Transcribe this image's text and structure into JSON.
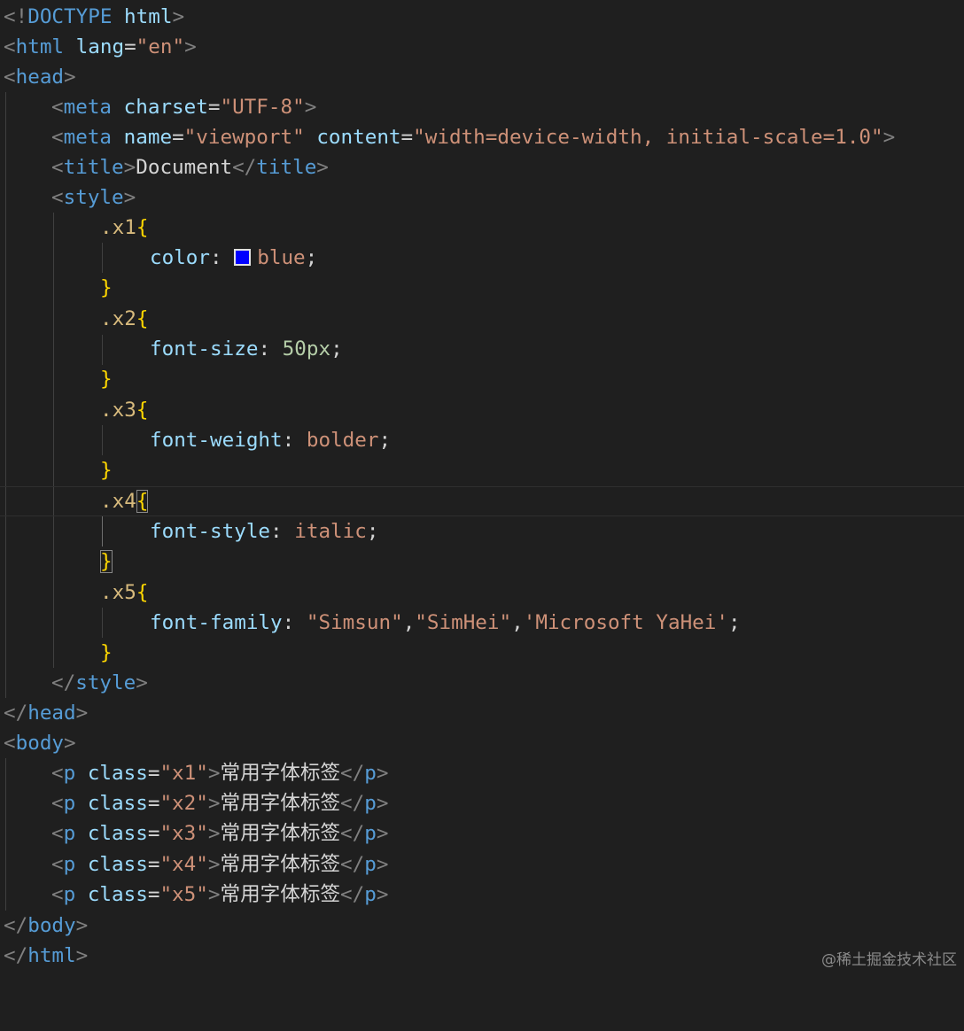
{
  "doctype": {
    "open": "<!",
    "keyword": "DOCTYPE",
    "name": "html",
    "close": ">"
  },
  "html_tag": {
    "name": "html",
    "attr": "lang",
    "eq": "=",
    "value": "\"en\""
  },
  "head_tag": {
    "name": "head"
  },
  "meta_charset": {
    "name": "meta",
    "attr": "charset",
    "eq": "=",
    "value": "\"UTF-8\""
  },
  "meta_viewport": {
    "name": "meta",
    "attr1": "name",
    "value1": "\"viewport\"",
    "attr2": "content",
    "value2": "\"width=device-width, initial-scale=1.0\""
  },
  "title_tag": {
    "name": "title",
    "text": "Document"
  },
  "style_tag": {
    "name": "style"
  },
  "css_rules": [
    {
      "selector": ".x1",
      "property": "color",
      "value": "blue",
      "swatch_color": "#0000ff"
    },
    {
      "selector": ".x2",
      "property": "font-size",
      "value": "50px"
    },
    {
      "selector": ".x3",
      "property": "font-weight",
      "value": "bolder"
    },
    {
      "selector": ".x4",
      "property": "font-style",
      "value": "italic"
    },
    {
      "selector": ".x5",
      "property": "font-family",
      "value_parts": [
        "\"Simsun\"",
        ",",
        "\"SimHei\"",
        ",",
        "'Microsoft YaHei'"
      ]
    }
  ],
  "punct": {
    "lt": "<",
    "lt_slash": "</",
    "gt": ">",
    "open_brace": "{",
    "close_brace": "}",
    "colon": ":",
    "semicolon": ";",
    "eq": "="
  },
  "body_tag": {
    "name": "body"
  },
  "paragraphs": [
    {
      "tag": "p",
      "attr": "class",
      "class_value": "\"x1\"",
      "text": "常用字体标签"
    },
    {
      "tag": "p",
      "attr": "class",
      "class_value": "\"x2\"",
      "text": "常用字体标签"
    },
    {
      "tag": "p",
      "attr": "class",
      "class_value": "\"x3\"",
      "text": "常用字体标签"
    },
    {
      "tag": "p",
      "attr": "class",
      "class_value": "\"x4\"",
      "text": "常用字体标签"
    },
    {
      "tag": "p",
      "attr": "class",
      "class_value": "\"x5\"",
      "text": "常用字体标签"
    }
  ],
  "watermark": "@稀土掘金技术社区",
  "colors": {
    "background": "#1f1f1f",
    "tag": "#569cd6",
    "attribute": "#9cdcfe",
    "string": "#ce9178",
    "selector": "#d7ba7d",
    "brace": "#ffd700",
    "number": "#b5cea8",
    "bracket": "#808080"
  }
}
